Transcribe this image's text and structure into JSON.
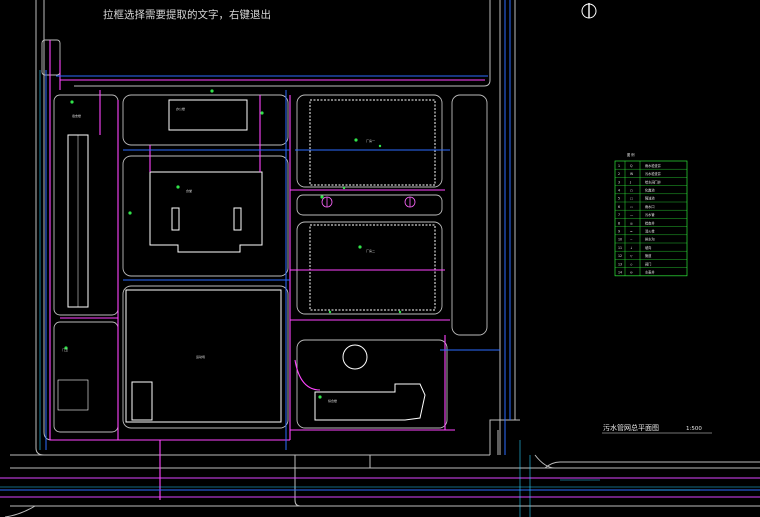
{
  "viewer": {
    "hint_text": "拉框选择需要提取的文字，右键退出"
  },
  "drawing": {
    "plan_title": "污水管网总平面图",
    "scale": "1:500",
    "colors": {
      "background": "#000000",
      "road": "#c9c9c9",
      "building": "#ffffff",
      "sewer_pipe": "#ff44ff",
      "rain_pipe": "#2b6cff",
      "water_pipe": "#2ad2ff",
      "green_label": "#31e34a",
      "legend_border": "#2ee63a"
    }
  },
  "legend": {
    "header": "图 例",
    "rows": [
      {
        "no": "1",
        "sym": "Q",
        "text": "雨水检查井"
      },
      {
        "no": "2",
        "sym": "W",
        "text": "污水检查井"
      },
      {
        "no": "3",
        "sym": "J",
        "text": "给水阀门井"
      },
      {
        "no": "4",
        "sym": "○",
        "text": "化粪池"
      },
      {
        "no": "5",
        "sym": "□",
        "text": "隔油池"
      },
      {
        "no": "6",
        "sym": "▭",
        "text": "雨水口"
      },
      {
        "no": "7",
        "sym": "—",
        "text": "污水管"
      },
      {
        "no": "8",
        "sym": "◎",
        "text": "检查井"
      },
      {
        "no": "9",
        "sym": "≈",
        "text": "消火栓"
      },
      {
        "no": "10",
        "sym": "~",
        "text": "排水沟"
      },
      {
        "no": "11",
        "sym": "↓",
        "text": "坡向"
      },
      {
        "no": "12",
        "sym": "▽",
        "text": "管道"
      },
      {
        "no": "13",
        "sym": "◇",
        "text": "阀门"
      },
      {
        "no": "14",
        "sym": "⊖",
        "text": "水表井"
      }
    ]
  },
  "buildings": [
    {
      "label": "宿舍楼"
    },
    {
      "label": "办公楼"
    },
    {
      "label": "厂房一"
    },
    {
      "label": "厂房二"
    },
    {
      "label": "食堂"
    },
    {
      "label": "综合楼"
    },
    {
      "label": "运动场"
    },
    {
      "label": "门卫"
    }
  ]
}
